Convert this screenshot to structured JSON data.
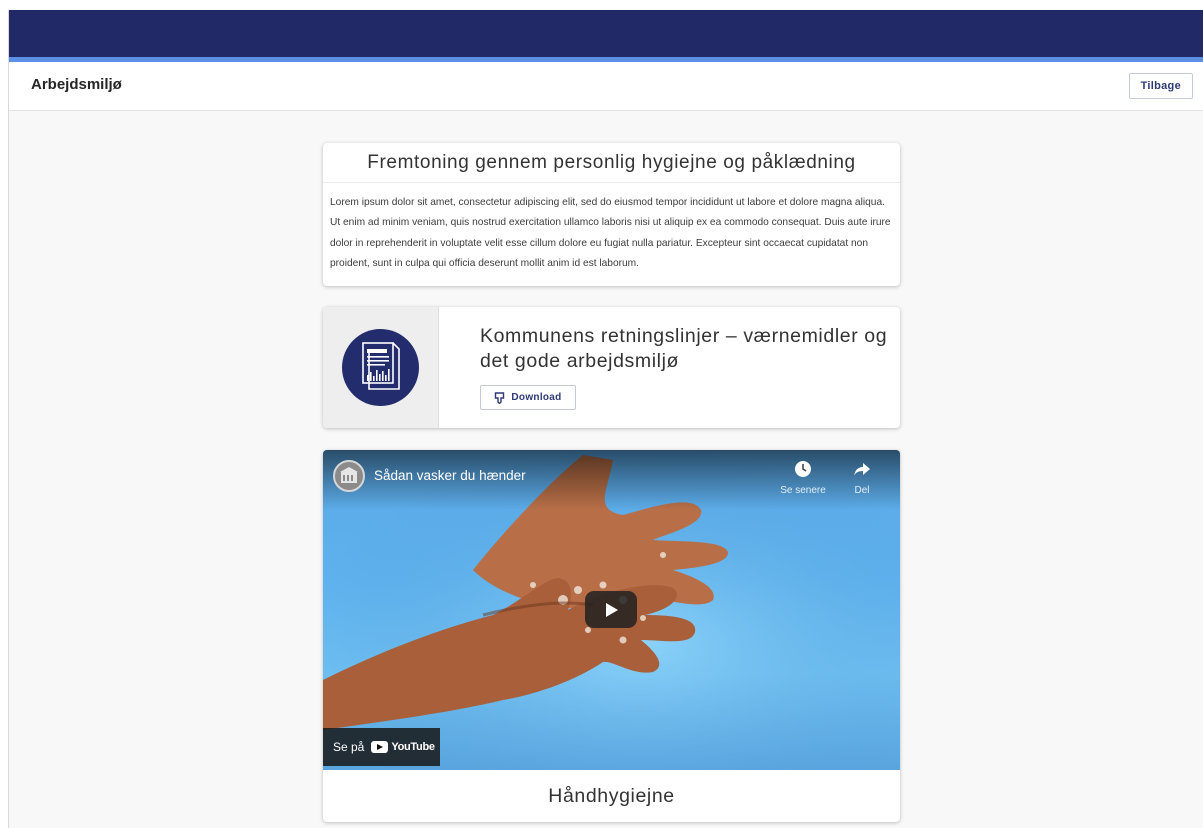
{
  "header": {
    "page_title": "Arbejdsmiljø",
    "back_label": "Tilbage"
  },
  "text_card": {
    "title": "Fremtoning gennem personlig hygiejne og påklædning",
    "body": "Lorem ipsum dolor sit amet, consectetur adipiscing elit, sed do eiusmod tempor incididunt ut labore et dolore magna aliqua. Ut enim ad minim veniam, quis nostrud exercitation ullamco laboris nisi ut aliquip ex ea commodo consequat. Duis aute irure dolor in reprehenderit in voluptate velit esse cillum dolore eu fugiat nulla pariatur. Excepteur sint occaecat cupidatat non proident, sunt in culpa qui officia deserunt mollit anim id est laborum."
  },
  "document_card": {
    "title": "Kommunens retningslinjer – værnemidler og det gode arbejdsmiljø",
    "download_label": "Download",
    "icon": "document-report-icon"
  },
  "video_card": {
    "video_title": "Sådan vasker du hænder",
    "watch_later_label": "Se senere",
    "share_label": "Del",
    "watch_on_label": "Se på",
    "youtube_label": "YouTube",
    "caption": "Håndhygiejne"
  },
  "colors": {
    "topbar": "#212a66",
    "accent": "#5c8fe6",
    "button_text": "#2d3a72",
    "icon_circle": "#232c6c"
  }
}
